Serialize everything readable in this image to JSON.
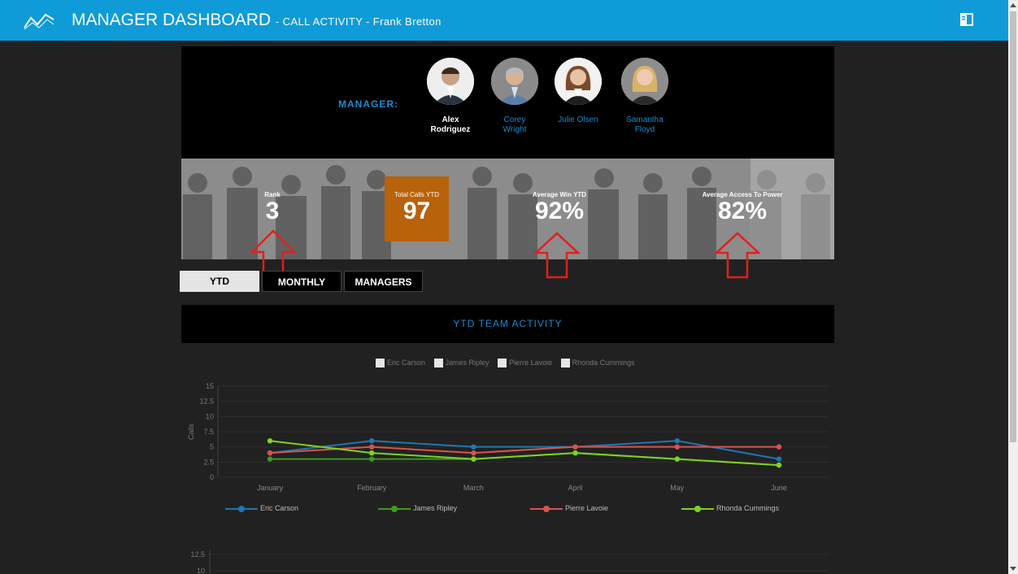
{
  "header": {
    "title": "MANAGER DASHBOARD",
    "subtitle": "- CALL ACTIVITY - Frank Bretton"
  },
  "managers": {
    "label": "MANAGER:",
    "items": [
      {
        "name": "Alex\nRodriguez",
        "active": true
      },
      {
        "name": "Corey\nWright",
        "active": false
      },
      {
        "name": "Julie Olsen",
        "active": false
      },
      {
        "name": "Samantha\nFloyd",
        "active": false
      }
    ]
  },
  "stats": {
    "rank": {
      "label": "Rank",
      "value": "3"
    },
    "total_calls": {
      "label": "Total Calls YTD",
      "value": "97"
    },
    "avg_win": {
      "label": "Average Win YTD",
      "value": "92%"
    },
    "avg_access": {
      "label": "Average Access To Power",
      "value": "82%"
    }
  },
  "tabs": [
    {
      "label": "YTD",
      "active": true
    },
    {
      "label": "MONTHLY",
      "active": false
    },
    {
      "label": "MANAGERS",
      "active": false
    }
  ],
  "section": {
    "title": "YTD TEAM ACTIVITY"
  },
  "top_legend": [
    "Eric Carson",
    "James Ripley",
    "Pierre Lavoie",
    "Rhonda Cummings"
  ],
  "colors": {
    "accent": "#0f9bd7",
    "orange": "#b8620a",
    "label_blue": "#1a8ad1"
  },
  "chart_data": [
    {
      "type": "line",
      "ylabel": "Calls",
      "xlabel": "",
      "ylim": [
        0,
        15
      ],
      "yticks": [
        "0",
        "2.5",
        "5",
        "7.5",
        "10",
        "12.5",
        "15"
      ],
      "categories": [
        "January",
        "February",
        "March",
        "April",
        "May",
        "June"
      ],
      "legend_position": "bottom",
      "series": [
        {
          "name": "Eric Carson",
          "color": "#1f77b4",
          "values": [
            4,
            6,
            5,
            5,
            6,
            3
          ]
        },
        {
          "name": "James Ripley",
          "color": "#3f9a1c",
          "values": [
            3,
            3,
            3,
            4,
            3,
            2
          ]
        },
        {
          "name": "Pierre Lavoie",
          "color": "#d9534f",
          "values": [
            4,
            5,
            4,
            5,
            5,
            5
          ]
        },
        {
          "name": "Rhonda Cummings",
          "color": "#7ed321",
          "values": [
            6,
            4,
            3,
            4,
            3,
            2
          ]
        }
      ]
    },
    {
      "type": "line",
      "yticks": [
        "12.5",
        "10"
      ],
      "series": []
    }
  ]
}
